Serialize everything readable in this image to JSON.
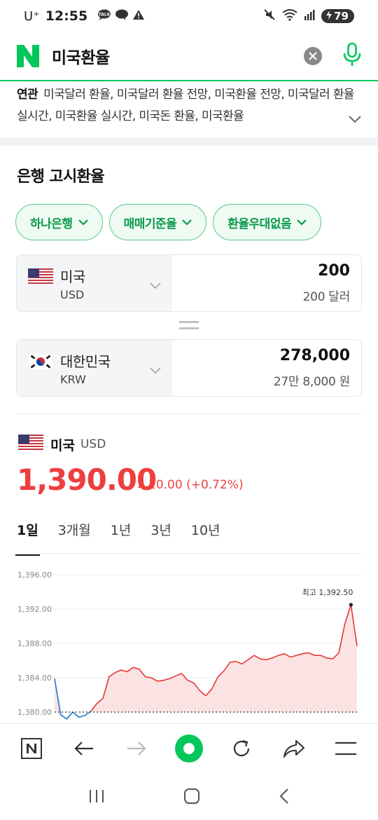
{
  "status_bar": {
    "carrier": "U⁺",
    "time": "12:55",
    "battery": "79"
  },
  "search": {
    "query": "미국환율"
  },
  "related": {
    "label": "연관",
    "text": "미국달러 환율, 미국달러 환율 전망, 미국환율 전망, 미국달러 환율 실시간, 미국환율 실시간, 미국돈 환율, 미국환율"
  },
  "section": {
    "title": "은행 고시환율"
  },
  "chips": [
    {
      "label": "하나은행"
    },
    {
      "label": "매매기준율"
    },
    {
      "label": "환율우대없음"
    }
  ],
  "converter": {
    "from": {
      "name": "미국",
      "code": "USD",
      "amount": "200",
      "amount_words": "200 달러"
    },
    "to": {
      "name": "대한민국",
      "code": "KRW",
      "amount": "278,000",
      "amount_words": "27만 8,000 원"
    }
  },
  "rate": {
    "name": "미국",
    "code": "USD",
    "value": "1,390.00",
    "change": "10.00 (+0.72%)",
    "up_color": "#ee3f3f"
  },
  "tabs": [
    {
      "label": "1일",
      "active": true
    },
    {
      "label": "3개월",
      "active": false
    },
    {
      "label": "1년",
      "active": false
    },
    {
      "label": "3년",
      "active": false
    },
    {
      "label": "10년",
      "active": false
    }
  ],
  "chart_data": {
    "type": "line",
    "ylim": [
      1378.5,
      1396.8
    ],
    "yticks": [
      "1,396.00",
      "1,392.00",
      "1,388.00",
      "1,384.00",
      "1,380.00"
    ],
    "ytick_values": [
      1396,
      1392,
      1388,
      1384,
      1380
    ],
    "baseline": 1380,
    "max_label": "최고 1,392.50",
    "max_value": 1392.5,
    "color_up": "#e53935",
    "color_down": "#1e88e5",
    "fill_up": "#fbe3e3",
    "x": [
      0,
      2,
      4,
      6,
      8,
      10,
      12,
      14,
      16,
      18,
      20,
      22,
      24,
      26,
      28,
      30,
      32,
      34,
      36,
      38,
      40,
      42,
      44,
      46,
      48,
      50,
      52,
      54,
      56,
      58,
      60,
      62,
      64,
      66,
      68,
      70,
      72,
      74,
      76,
      78,
      80,
      82,
      84,
      86,
      88,
      90,
      92,
      94,
      96,
      98,
      100
    ],
    "values": [
      1383.9,
      1379.7,
      1379.2,
      1380.0,
      1379.4,
      1379.6,
      1380.1,
      1381.0,
      1381.6,
      1384.1,
      1384.6,
      1384.9,
      1384.7,
      1385.2,
      1385.0,
      1384.1,
      1384.0,
      1383.6,
      1383.7,
      1383.9,
      1384.2,
      1384.5,
      1383.7,
      1383.4,
      1382.5,
      1381.9,
      1382.7,
      1384.1,
      1384.8,
      1385.8,
      1385.9,
      1385.6,
      1386.1,
      1386.6,
      1386.2,
      1386.1,
      1386.3,
      1386.6,
      1386.8,
      1386.4,
      1386.6,
      1386.8,
      1386.9,
      1386.6,
      1386.6,
      1386.3,
      1386.2,
      1386.9,
      1390.3,
      1392.5,
      1387.7
    ]
  }
}
